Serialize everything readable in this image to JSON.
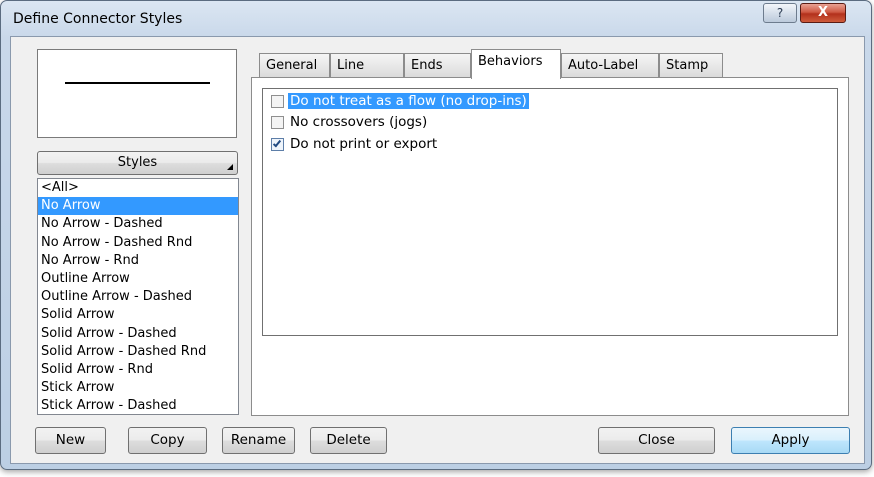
{
  "window": {
    "title": "Define Connector Styles",
    "help_label": "?",
    "close_label": "X"
  },
  "styles_panel": {
    "dropdown_label": "Styles",
    "items": [
      "<All>",
      "No Arrow",
      "No Arrow - Dashed",
      "No Arrow - Dashed Rnd",
      "No Arrow - Rnd",
      "Outline Arrow",
      "Outline Arrow - Dashed",
      "Solid Arrow",
      "Solid Arrow - Dashed",
      "Solid Arrow - Dashed Rnd",
      "Solid Arrow - Rnd",
      "Stick Arrow",
      "Stick Arrow - Dashed"
    ],
    "selected_index": 1
  },
  "tabs": [
    "General",
    "Line",
    "Ends",
    "Behaviors",
    "Auto-Label",
    "Stamp"
  ],
  "active_tab": "Behaviors",
  "behaviors": {
    "options": [
      {
        "label": "Do not treat as a flow (no drop-ins)",
        "checked": false,
        "highlighted": true
      },
      {
        "label": "No crossovers (jogs)",
        "checked": false,
        "highlighted": false
      },
      {
        "label": "Do not print or export",
        "checked": true,
        "highlighted": false
      }
    ]
  },
  "buttons": {
    "new": "New",
    "copy": "Copy",
    "rename": "Rename",
    "delete": "Delete",
    "close": "Close",
    "apply": "Apply"
  },
  "colors": {
    "selection": "#3399ff",
    "default_button": "#bee6fd",
    "close_button": "#c0392b"
  }
}
